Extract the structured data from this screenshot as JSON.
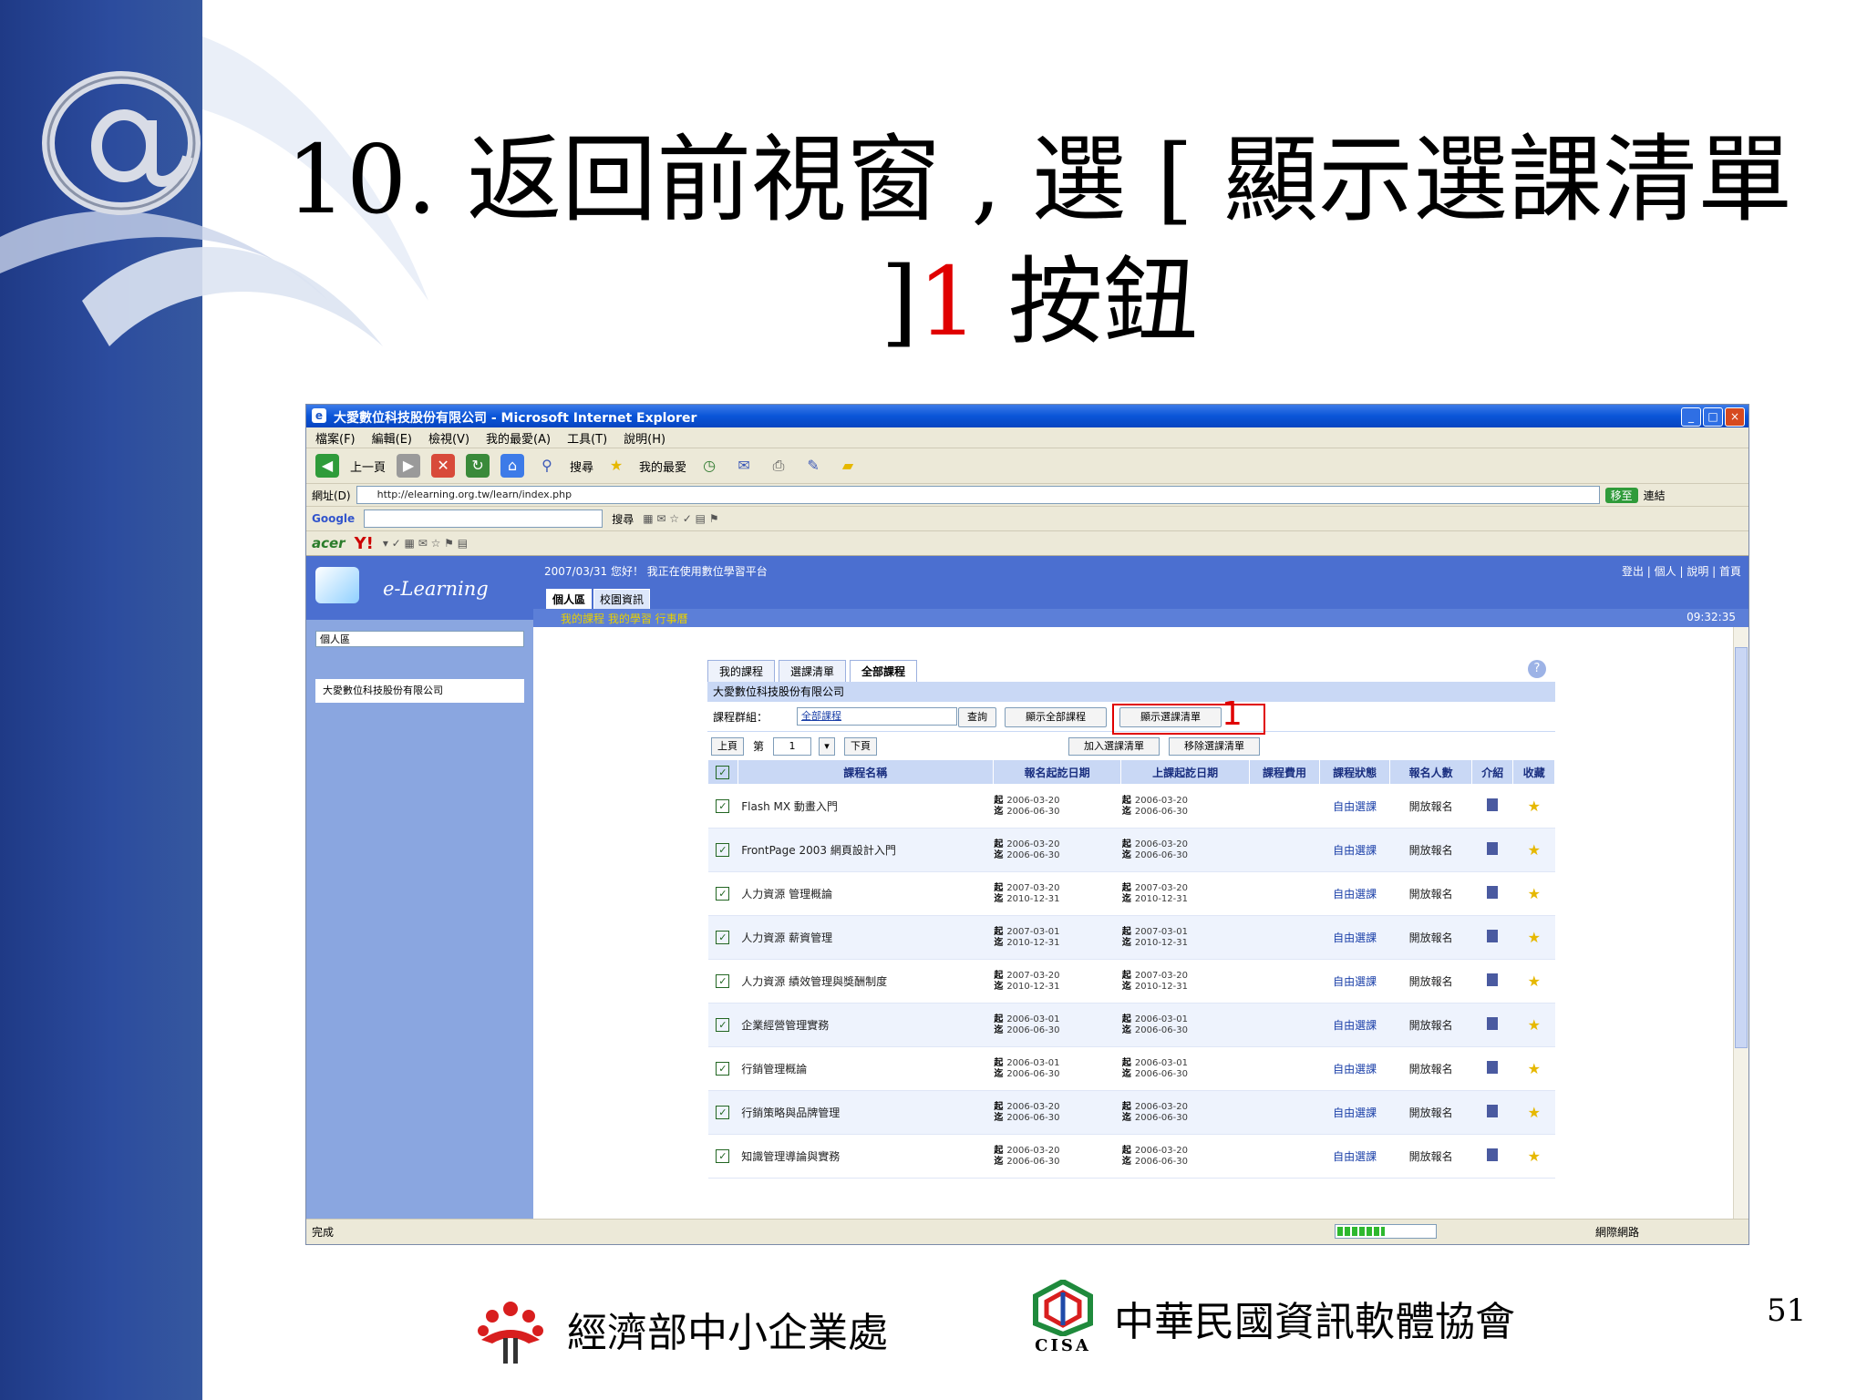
{
  "slide": {
    "title_prefix": "10. 返回前視窗 , 選 [ 顯示選課清單 ]",
    "title_number": "1",
    "title_suffix": " 按鈕",
    "page_number": "51",
    "footer_left": "經濟部中小企業處",
    "footer_right": "中華民國資訊軟體協會",
    "footer_right_logo_text": "CISA"
  },
  "browser": {
    "window_title": "大愛數位科技股份有限公司 - Microsoft Internet Explorer",
    "menu": [
      "檔案(F)",
      "編輯(E)",
      "檢視(V)",
      "我的最愛(A)",
      "工具(T)",
      "說明(H)"
    ],
    "toolbar": [
      "上一頁",
      "搜尋",
      "我的最愛"
    ],
    "address_label": "網址(D)",
    "address_value": "http://elearning.org.tw/learn/index.php",
    "go_label": "移至",
    "links_label": "連結",
    "google_label": "Google",
    "search_label": "搜尋",
    "status": "完成",
    "zone": "網際網路"
  },
  "app": {
    "logo_text": "e-Learning",
    "path_text": "2007/03/31 您好！ 我正在使用數位學習平台",
    "right_links": "登出 | 個人 | 說明 | 首頁",
    "tabs": [
      "個人區",
      "校園資訊"
    ],
    "left_select": "個人區",
    "left_item": "大愛數位科技股份有限公司",
    "subnav_links": "我的課程  我的學習  行事曆",
    "subnav_time": "09:32:35",
    "panel_tabs": [
      "我的課程",
      "選課清單",
      "全部課程"
    ],
    "company": "大愛數位科技股份有限公司",
    "filter_label": "課程群組：",
    "filter_value": "全部課程",
    "btn_query": "查詢",
    "btn_show_all": "顯示全部課程",
    "btn_show_selected": "顯示選課清單",
    "pager_prev": "上頁",
    "pager_page_label": "第",
    "pager_page_value": "1",
    "pager_next": "下頁",
    "btn_add": "加入選課清單",
    "btn_remove": "移除選課清單",
    "columns": [
      "",
      "課程名稱",
      "報名起訖日期",
      "上課起訖日期",
      "課程費用",
      "課程狀態",
      "報名人數",
      "介紹",
      "收藏"
    ],
    "rows": [
      {
        "name": "Flash MX 動畫入門",
        "e1": "2006-03-20",
        "e2": "2006-06-30",
        "s1": "2006-03-20",
        "s2": "2006-06-30",
        "mode": "自由選課",
        "status": "開放報名"
      },
      {
        "name": "FrontPage 2003 網頁設計入門",
        "e1": "2006-03-20",
        "e2": "2006-06-30",
        "s1": "2006-03-20",
        "s2": "2006-06-30",
        "mode": "自由選課",
        "status": "開放報名"
      },
      {
        "name": "人力資源 管理概論",
        "e1": "2007-03-20",
        "e2": "2010-12-31",
        "s1": "2007-03-20",
        "s2": "2010-12-31",
        "mode": "自由選課",
        "status": "開放報名"
      },
      {
        "name": "人力資源 薪資管理",
        "e1": "2007-03-01",
        "e2": "2010-12-31",
        "s1": "2007-03-01",
        "s2": "2010-12-31",
        "mode": "自由選課",
        "status": "開放報名"
      },
      {
        "name": "人力資源 績效管理與獎酬制度",
        "e1": "2007-03-20",
        "e2": "2010-12-31",
        "s1": "2007-03-20",
        "s2": "2010-12-31",
        "mode": "自由選課",
        "status": "開放報名"
      },
      {
        "name": "企業經營管理實務",
        "e1": "2006-03-01",
        "e2": "2006-06-30",
        "s1": "2006-03-01",
        "s2": "2006-06-30",
        "mode": "自由選課",
        "status": "開放報名"
      },
      {
        "name": "行銷管理概論",
        "e1": "2006-03-01",
        "e2": "2006-06-30",
        "s1": "2006-03-01",
        "s2": "2006-06-30",
        "mode": "自由選課",
        "status": "開放報名"
      },
      {
        "name": "行銷策略與品牌管理",
        "e1": "2006-03-20",
        "e2": "2006-06-30",
        "s1": "2006-03-20",
        "s2": "2006-06-30",
        "mode": "自由選課",
        "status": "開放報名"
      },
      {
        "name": "知識管理導論與實務",
        "e1": "2006-03-20",
        "e2": "2006-06-30",
        "s1": "2006-03-20",
        "s2": "2006-06-30",
        "mode": "自由選課",
        "status": "開放報名"
      }
    ]
  }
}
